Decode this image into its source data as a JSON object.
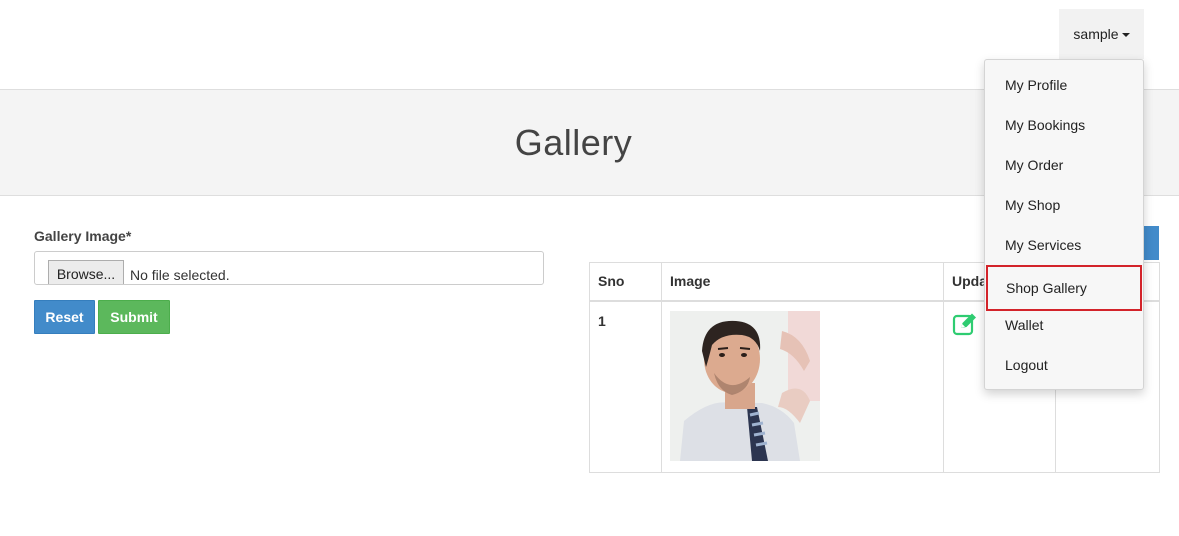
{
  "header": {
    "user_name": "sample"
  },
  "user_menu": {
    "items": [
      {
        "label": "My Profile"
      },
      {
        "label": "My Bookings"
      },
      {
        "label": "My Order"
      },
      {
        "label": "My Shop"
      },
      {
        "label": "My Services"
      },
      {
        "label": "Shop Gallery",
        "highlighted": true
      },
      {
        "label": "Wallet"
      },
      {
        "label": "Logout"
      }
    ]
  },
  "banner": {
    "title": "Gallery"
  },
  "form": {
    "label": "Gallery Image*",
    "browse_label": "Browse...",
    "file_status": "No file selected.",
    "reset_label": "Reset",
    "submit_label": "Submit"
  },
  "table": {
    "headers": [
      "Sno",
      "Image",
      "Update",
      ""
    ],
    "rows": [
      {
        "sno": "1",
        "image": "man-in-tie-photo",
        "update_icon": "edit-icon"
      }
    ]
  },
  "colors": {
    "primary": "#428bca",
    "success": "#5cb85c",
    "highlight_border": "#d3232a",
    "edit_icon": "#2ecc71"
  }
}
